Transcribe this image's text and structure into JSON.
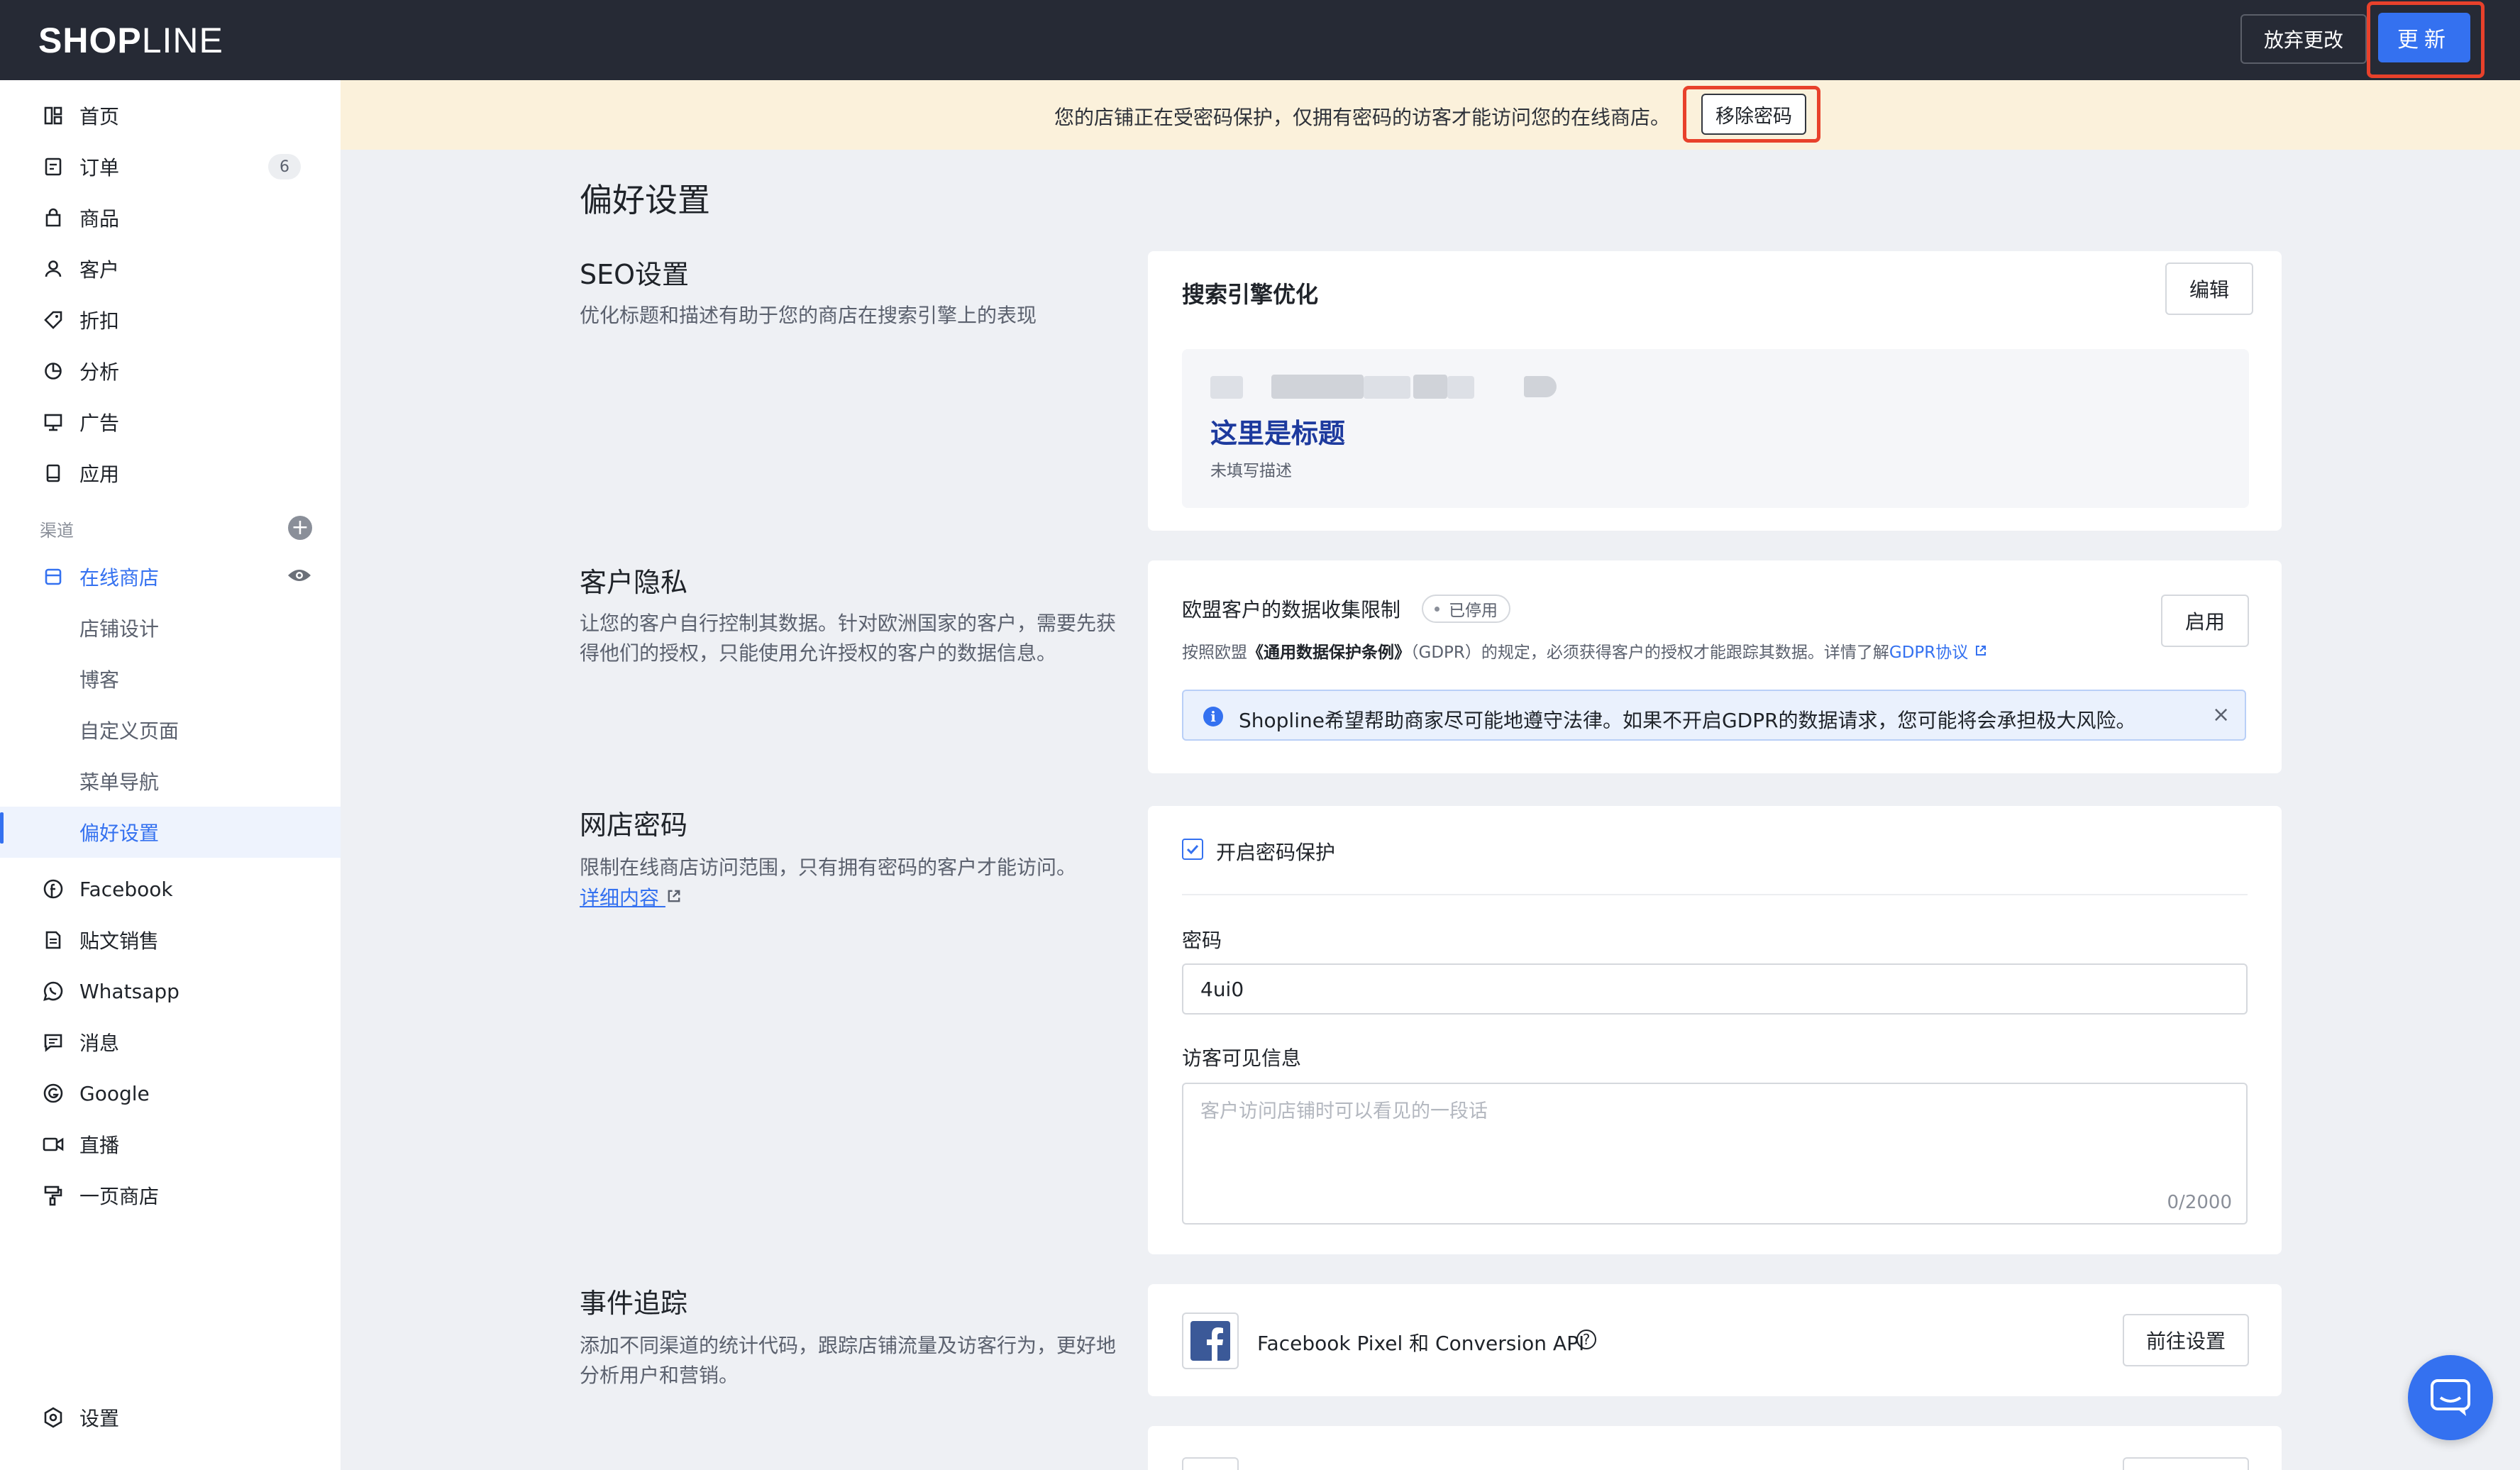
{
  "brand": {
    "logo_bold": "SHOP",
    "logo_light": "LINE",
    "accent": "#3471f0",
    "topbar_bg": "#262a35",
    "highlight": "#e8412b"
  },
  "topbar": {
    "discard_label": "放弃更改",
    "update_label": "更新"
  },
  "sidebar": {
    "items": [
      {
        "label": "首页",
        "icon": "dashboard-icon"
      },
      {
        "label": "订单",
        "icon": "order-icon",
        "badge": "6"
      },
      {
        "label": "商品",
        "icon": "bag-icon"
      },
      {
        "label": "客户",
        "icon": "user-icon"
      },
      {
        "label": "折扣",
        "icon": "tag-icon"
      },
      {
        "label": "分析",
        "icon": "pie-chart-icon"
      },
      {
        "label": "广告",
        "icon": "monitor-icon"
      },
      {
        "label": "应用",
        "icon": "app-icon"
      }
    ],
    "channels_label": "渠道",
    "online_store": {
      "label": "在线商店",
      "icon": "store-icon"
    },
    "sub_items": [
      {
        "label": "店铺设计"
      },
      {
        "label": "博客"
      },
      {
        "label": "自定义页面"
      },
      {
        "label": "菜单导航"
      },
      {
        "label": "偏好设置",
        "active": true
      }
    ],
    "channel_items": [
      {
        "label": "Facebook",
        "icon": "facebook-icon"
      },
      {
        "label": "贴文销售",
        "icon": "document-icon"
      },
      {
        "label": "Whatsapp",
        "icon": "whatsapp-icon"
      },
      {
        "label": "消息",
        "icon": "message-icon"
      },
      {
        "label": "Google",
        "icon": "google-icon"
      },
      {
        "label": "直播",
        "icon": "video-icon"
      },
      {
        "label": "一页商店",
        "icon": "paint-roller-icon"
      }
    ],
    "settings_label": "设置"
  },
  "banner": {
    "text": "您的店铺正在受密码保护，仅拥有密码的访客才能访问您的在线商店。",
    "button": "移除密码"
  },
  "page_title": "偏好设置",
  "seo": {
    "title": "SEO设置",
    "desc": "优化标题和描述有助于您的商店在搜索引擎上的表现",
    "card_title": "搜索引擎优化",
    "edit": "编辑",
    "preview_title": "这里是标题",
    "preview_desc": "未填写描述"
  },
  "privacy": {
    "title": "客户隐私",
    "desc": "让您的客户自行控制其数据。针对欧洲国家的客户，需要先获得他们的授权，只能使用允许授权的客户的数据信息。",
    "card_title": "欧盟客户的数据收集限制",
    "status": "已停用",
    "note_prefix": "按照欧盟",
    "note_law": "《通用数据保护条例》",
    "note_suffix": "（GDPR）的规定，必须获得客户的授权才能跟踪其数据。详情了解",
    "note_link": "GDPR协议",
    "enable": "启用",
    "alert": "Shopline希望帮助商家尽可能地遵守法律。如果不开启GDPR的数据请求，您可能将会承担极大风险。"
  },
  "password": {
    "title": "网店密码",
    "desc": "限制在线商店访问范围，只有拥有密码的客户才能访问。",
    "link": "详细内容",
    "checkbox_label": "开启密码保护",
    "checked": true,
    "password_label": "密码",
    "password_value": "4ui0",
    "visitor_label": "访客可见信息",
    "visitor_placeholder": "客户访问店铺时可以看见的一段话",
    "counter": "0/2000"
  },
  "tracking": {
    "title": "事件追踪",
    "desc": "添加不同渠道的统计代码，跟踪店铺流量及访客行为，更好地分析用户和营销。",
    "fb_label": "Facebook Pixel 和 Conversion API",
    "fb_button": "前往设置"
  }
}
